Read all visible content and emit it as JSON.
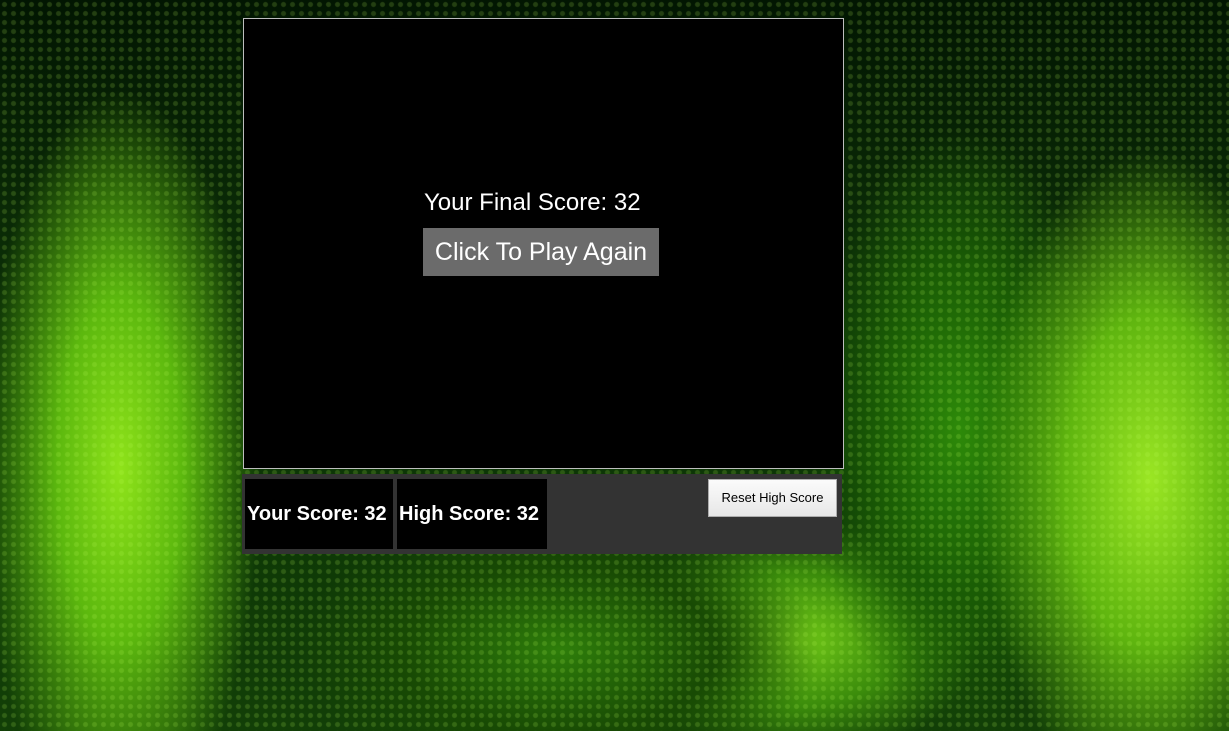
{
  "game": {
    "final_score_text": "Your Final Score: 32",
    "play_again_label": "Click To Play Again",
    "final_score": 32
  },
  "scoreboard": {
    "your_score_text": "Your Score: 32",
    "high_score_text": "High Score: 32",
    "your_score": 32,
    "high_score": 32,
    "reset_label": "Reset High Score"
  },
  "theme": {
    "canvas_bg": "#000000",
    "bar_bg": "#333333",
    "button_bg": "#6b6b6b",
    "text_color": "#ffffff",
    "background_accent": "#8fe31a"
  }
}
